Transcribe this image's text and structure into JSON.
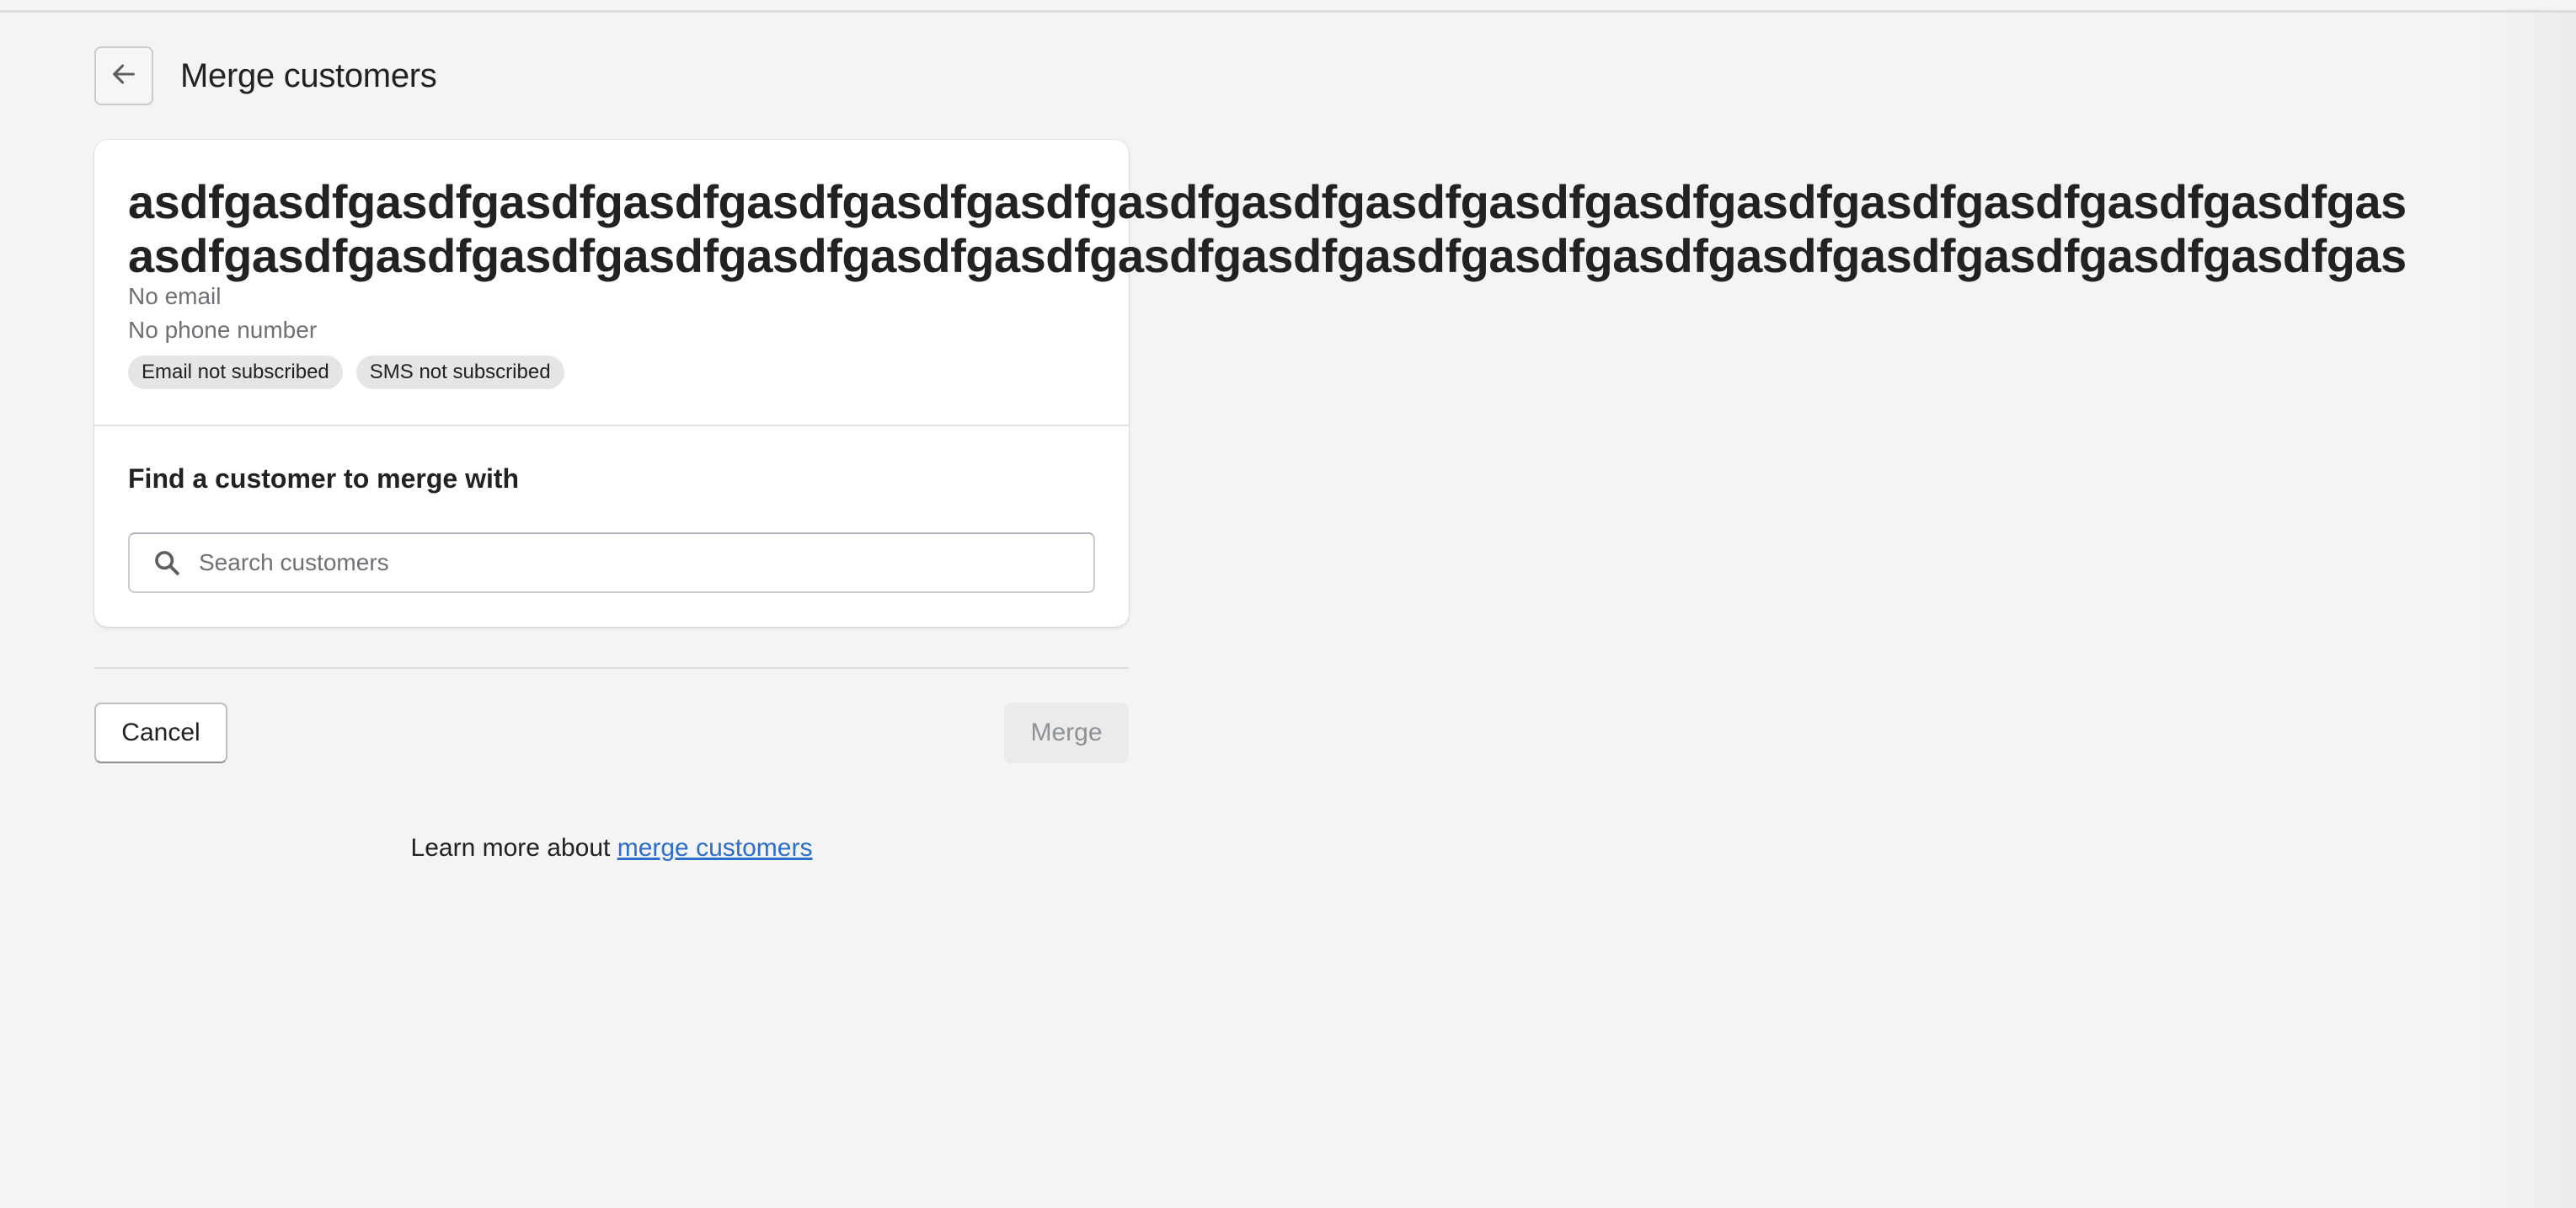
{
  "header": {
    "back_icon": "arrow-left-icon",
    "title": "Merge customers"
  },
  "customer": {
    "name_lines": [
      "asdfgasdfgasdfgasdfgasdfgasdfgasdfgasdfgasdfgasdfgasdfgasdfgasdfgasdfgasdfgasdfgasdfgasdfgas",
      "asdfgasdfgasdfgasdfgasdfgasdfgasdfgasdfgasdfgasdfgasdfgasdfgasdfgasdfgasdfgasdfgasdfgasdfgas"
    ],
    "email": "No email",
    "phone": "No phone number",
    "badges": [
      "Email not subscribed",
      "SMS not subscribed"
    ]
  },
  "search": {
    "section_title": "Find a customer to merge with",
    "icon": "search-icon",
    "placeholder": "Search customers",
    "value": ""
  },
  "actions": {
    "cancel_label": "Cancel",
    "merge_label": "Merge",
    "merge_disabled": true
  },
  "footer": {
    "learn_more_prefix": "Learn more about ",
    "learn_more_link": "merge customers"
  },
  "colors": {
    "background": "#f4f4f4",
    "card": "#ffffff",
    "link": "#2c6ecb",
    "badge": "#e4e5e7",
    "disabled_button": "#ebebeb"
  }
}
